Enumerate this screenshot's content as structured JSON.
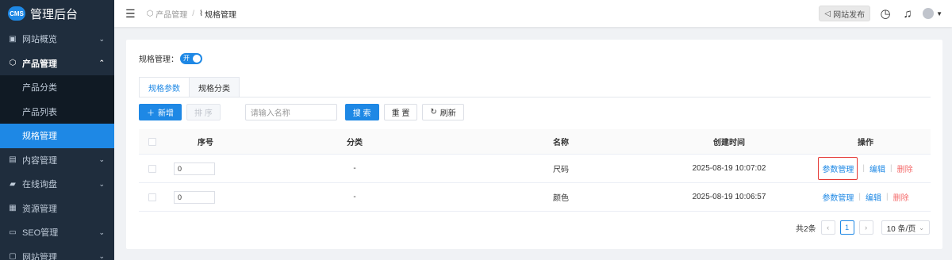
{
  "app": {
    "logo_badge": "CMS",
    "title": "管理后台"
  },
  "sidebar": {
    "items": [
      {
        "label": "网站概览",
        "icon": "dashboard-icon",
        "arrow": "⌄"
      },
      {
        "label": "产品管理",
        "icon": "box-icon",
        "arrow": "⌃",
        "open": true
      },
      {
        "label": "内容管理",
        "icon": "document-icon",
        "arrow": "⌄"
      },
      {
        "label": "在线询盘",
        "icon": "chat-icon",
        "arrow": "⌄"
      },
      {
        "label": "资源管理",
        "icon": "folder-icon",
        "arrow": ""
      },
      {
        "label": "SEO管理",
        "icon": "monitor-icon",
        "arrow": "⌄"
      },
      {
        "label": "网站管理",
        "icon": "window-icon",
        "arrow": "⌄"
      }
    ],
    "subitems": [
      {
        "label": "产品分类"
      },
      {
        "label": "产品列表"
      },
      {
        "label": "规格管理",
        "active": true
      }
    ]
  },
  "topbar": {
    "breadcrumb": [
      "产品管理",
      "规格管理"
    ],
    "breadcrumb_sep": "/",
    "publish_label": "网站发布"
  },
  "page": {
    "switch_label": "规格管理：",
    "switch_text": "开",
    "tabs": [
      {
        "label": "规格参数",
        "active": true
      },
      {
        "label": "规格分类"
      }
    ],
    "toolbar": {
      "add_label": "新增",
      "sort_label": "排 序",
      "search_placeholder": "请输入名称",
      "search_label": "搜 索",
      "reset_label": "重 置",
      "refresh_label": "刷新"
    },
    "table": {
      "headers": {
        "seq": "序号",
        "category": "分类",
        "name": "名称",
        "created": "创建时间",
        "ops": "操作"
      },
      "rows": [
        {
          "seq": "0",
          "category": "-",
          "name": "尺码",
          "created": "2025-08-19 10:07:02"
        },
        {
          "seq": "0",
          "category": "-",
          "name": "颜色",
          "created": "2025-08-19 10:06:57"
        }
      ],
      "ops": {
        "params": "参数管理",
        "edit": "编辑",
        "delete": "删除",
        "sep": "|"
      }
    },
    "pagination": {
      "total": "共2条",
      "current": "1",
      "page_size": "10 条/页"
    }
  },
  "colors": {
    "accent": "#1e88e5",
    "sidebar_bg": "#1f2d3d",
    "danger": "#f56c6c",
    "highlight": "#e53935"
  }
}
